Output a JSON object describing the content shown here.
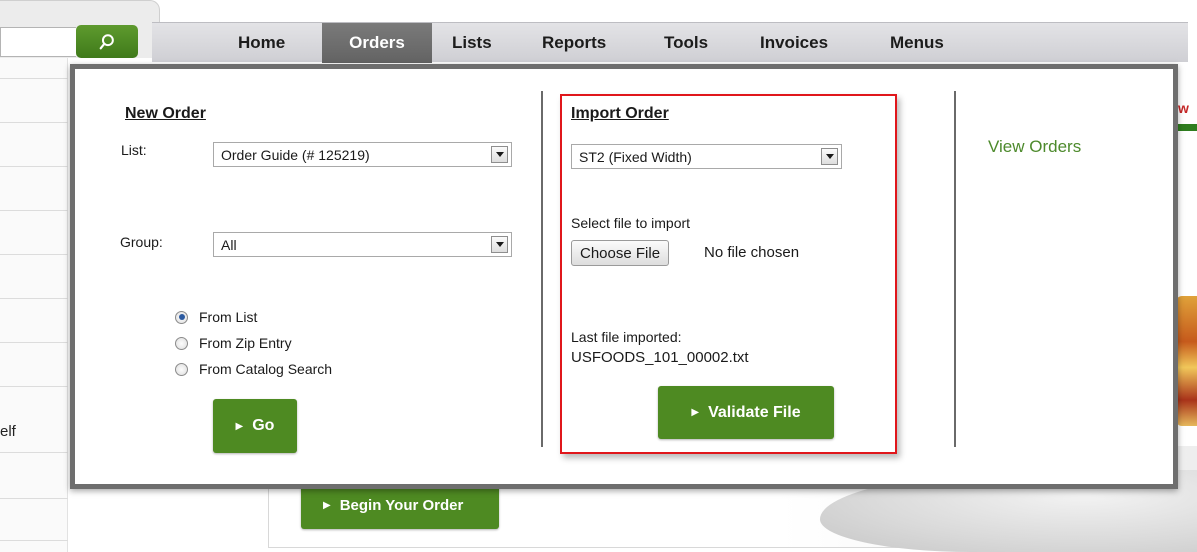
{
  "nav": {
    "items": [
      "Home",
      "Orders",
      "Lists",
      "Reports",
      "Tools",
      "Invoices",
      "Menus"
    ],
    "active": "Orders"
  },
  "search": {
    "icon": "search-icon",
    "value": ""
  },
  "background": {
    "left_stub_text": "elf",
    "begin_order_label": "Begin Your Order",
    "right_tab_fragment": "w"
  },
  "new_order": {
    "title": "New Order",
    "list_label": "List:",
    "list_selected": "Order Guide (# 125219)",
    "group_label": "Group:",
    "group_selected": "All",
    "options": [
      {
        "label": "From List",
        "checked": true
      },
      {
        "label": "From Zip Entry",
        "checked": false
      },
      {
        "label": "From Catalog Search",
        "checked": false
      }
    ],
    "go_label": "Go"
  },
  "import_order": {
    "title": "Import Order",
    "format_selected": "ST2 (Fixed Width)",
    "select_file_label": "Select file to import",
    "choose_file_label": "Choose File",
    "no_file_text": "No file chosen",
    "last_file_label": "Last file imported:",
    "last_file_value": "USFOODS_101_00002.txt",
    "validate_label": "Validate File"
  },
  "view_orders_label": "View Orders",
  "colors": {
    "brand_green": "#4e8a22",
    "link_green": "#4d8a2c",
    "highlight_red": "#e0161b",
    "nav_active": "#6e6e6e"
  }
}
